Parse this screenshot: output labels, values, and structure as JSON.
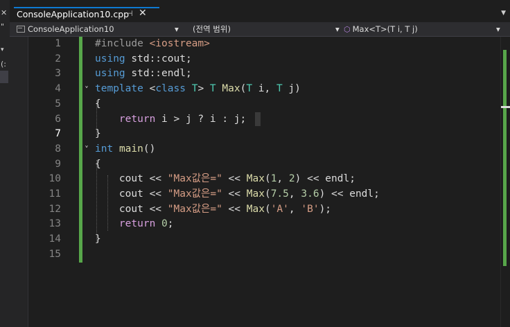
{
  "tab": {
    "title": "ConsoleApplication10.cpp",
    "pin": "⊣",
    "close": "✕"
  },
  "navbar": {
    "project": "ConsoleApplication10",
    "scope": "(전역 범위)",
    "member": "Max<T>(T i, T j)"
  },
  "left_strip": {
    "glyphs": [
      "✕",
      "\"",
      "▾",
      "(:"
    ]
  },
  "editor": {
    "current_line": 7,
    "line_numbers": [
      "1",
      "2",
      "3",
      "4",
      "5",
      "6",
      "7",
      "8",
      "9",
      "10",
      "11",
      "12",
      "13",
      "14",
      "15"
    ],
    "lines": [
      {
        "tokens": [
          {
            "t": "#include ",
            "c": "pp"
          },
          {
            "t": "<iostream>",
            "c": "inc"
          }
        ]
      },
      {
        "tokens": [
          {
            "t": "using",
            "c": "kw"
          },
          {
            "t": " std::cout;",
            "c": "p"
          }
        ]
      },
      {
        "tokens": [
          {
            "t": "using",
            "c": "kw"
          },
          {
            "t": " std::endl;",
            "c": "p"
          }
        ]
      },
      {
        "tokens": [
          {
            "t": "template",
            "c": "kw"
          },
          {
            "t": " <",
            "c": "p"
          },
          {
            "t": "class",
            "c": "kw"
          },
          {
            "t": " ",
            "c": "p"
          },
          {
            "t": "T",
            "c": "ty"
          },
          {
            "t": "> ",
            "c": "p"
          },
          {
            "t": "T",
            "c": "ty"
          },
          {
            "t": " ",
            "c": "p"
          },
          {
            "t": "Max",
            "c": "fn"
          },
          {
            "t": "(",
            "c": "p"
          },
          {
            "t": "T",
            "c": "ty"
          },
          {
            "t": " i, ",
            "c": "p"
          },
          {
            "t": "T",
            "c": "ty"
          },
          {
            "t": " j)",
            "c": "p"
          }
        ]
      },
      {
        "tokens": [
          {
            "t": "{",
            "c": "p"
          }
        ]
      },
      {
        "tokens": [
          {
            "t": "    ",
            "c": "p"
          },
          {
            "t": "return",
            "c": "kw2"
          },
          {
            "t": " i > j ? i : j;",
            "c": "p"
          }
        ]
      },
      {
        "tokens": [
          {
            "t": "}",
            "c": "p"
          }
        ]
      },
      {
        "tokens": [
          {
            "t": "int",
            "c": "kw"
          },
          {
            "t": " ",
            "c": "p"
          },
          {
            "t": "main",
            "c": "fn"
          },
          {
            "t": "()",
            "c": "p"
          }
        ]
      },
      {
        "tokens": [
          {
            "t": "{",
            "c": "p"
          }
        ]
      },
      {
        "tokens": [
          {
            "t": "    cout << ",
            "c": "p"
          },
          {
            "t": "\"Max값은=\"",
            "c": "str"
          },
          {
            "t": " << ",
            "c": "p"
          },
          {
            "t": "Max",
            "c": "fn"
          },
          {
            "t": "(",
            "c": "p"
          },
          {
            "t": "1",
            "c": "num"
          },
          {
            "t": ", ",
            "c": "p"
          },
          {
            "t": "2",
            "c": "num"
          },
          {
            "t": ") << endl;",
            "c": "p"
          }
        ]
      },
      {
        "tokens": [
          {
            "t": "    cout << ",
            "c": "p"
          },
          {
            "t": "\"Max값은=\"",
            "c": "str"
          },
          {
            "t": " << ",
            "c": "p"
          },
          {
            "t": "Max",
            "c": "fn"
          },
          {
            "t": "(",
            "c": "p"
          },
          {
            "t": "7.5",
            "c": "num"
          },
          {
            "t": ", ",
            "c": "p"
          },
          {
            "t": "3.6",
            "c": "num"
          },
          {
            "t": ") << endl;",
            "c": "p"
          }
        ]
      },
      {
        "tokens": [
          {
            "t": "    cout << ",
            "c": "p"
          },
          {
            "t": "\"Max값은=\"",
            "c": "str"
          },
          {
            "t": " << ",
            "c": "p"
          },
          {
            "t": "Max",
            "c": "fn"
          },
          {
            "t": "(",
            "c": "p"
          },
          {
            "t": "'A'",
            "c": "str"
          },
          {
            "t": ", ",
            "c": "p"
          },
          {
            "t": "'B'",
            "c": "str"
          },
          {
            "t": ");",
            "c": "p"
          }
        ]
      },
      {
        "tokens": [
          {
            "t": "    ",
            "c": "p"
          },
          {
            "t": "return",
            "c": "kw2"
          },
          {
            "t": " ",
            "c": "p"
          },
          {
            "t": "0",
            "c": "num"
          },
          {
            "t": ";",
            "c": "p"
          }
        ]
      },
      {
        "tokens": [
          {
            "t": "}",
            "c": "p"
          }
        ]
      },
      {
        "tokens": []
      }
    ]
  }
}
